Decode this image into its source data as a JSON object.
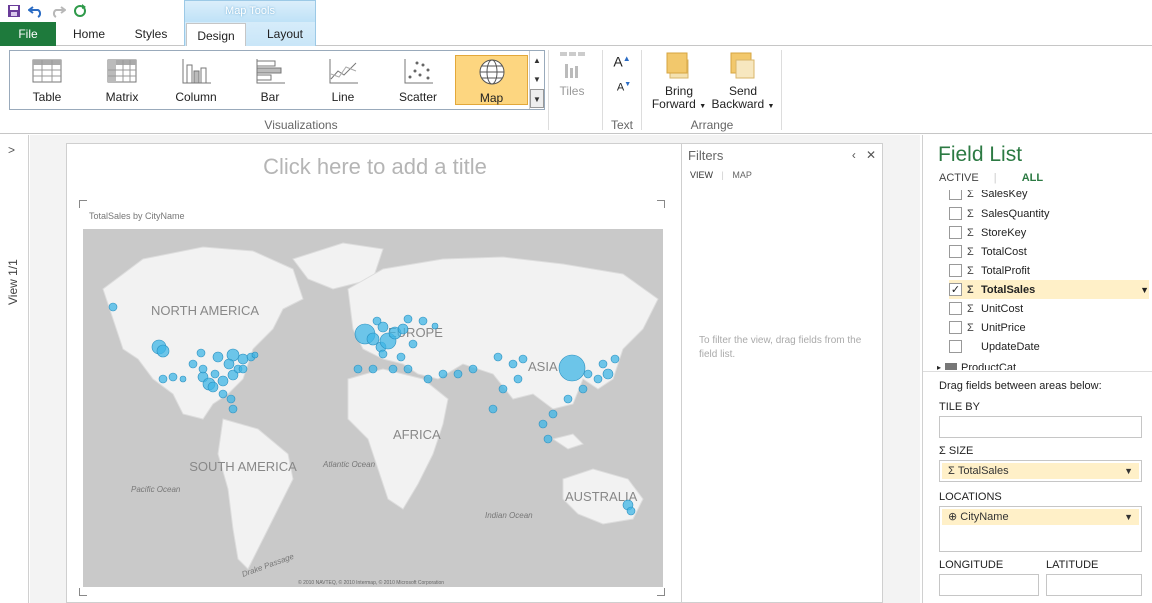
{
  "ribbon_tabs": {
    "file": "File",
    "home": "Home",
    "styles": "Styles",
    "context_group": "Map Tools",
    "design": "Design",
    "layout": "Layout"
  },
  "visualizations": {
    "items": [
      "Table",
      "Matrix",
      "Column",
      "Bar",
      "Line",
      "Scatter",
      "Map"
    ],
    "selected": "Map",
    "group_label": "Visualizations"
  },
  "tiles_label": "Tiles",
  "text_group_label": "Text",
  "arrange": {
    "bring_forward_line1": "Bring",
    "bring_forward_line2": "Forward",
    "send_backward_line1": "Send",
    "send_backward_line2": "Backward",
    "group_label": "Arrange"
  },
  "left_pane": {
    "label": "View  1/1"
  },
  "canvas": {
    "title_placeholder": "Click here to add a title",
    "map_caption": "TotalSales by CityName",
    "map_labels": {
      "north_america": "NORTH AMERICA",
      "europe": "EUROPE",
      "asia": "ASIA",
      "africa": "AFRICA",
      "south_america": "SOUTH AMERICA",
      "australia": "AUSTRALIA",
      "atlantic": "Atlantic Ocean",
      "pacific": "Pacific Ocean",
      "indian": "Indian Ocean",
      "drake": "Drake Passage",
      "copyright": "© 2010 NAVTEQ, © 2010 Intermap, © 2010 Microsoft Corporation"
    }
  },
  "filters": {
    "title": "Filters",
    "tab_view": "VIEW",
    "tab_map": "MAP",
    "hint": "To filter the view, drag fields from the field list."
  },
  "field_list": {
    "title": "Field List",
    "tab_active": "ACTIVE",
    "tab_all": "ALL",
    "fields": [
      {
        "name": "SalesKey",
        "checked": false,
        "sigma": true
      },
      {
        "name": "SalesQuantity",
        "checked": false,
        "sigma": true
      },
      {
        "name": "StoreKey",
        "checked": false,
        "sigma": true
      },
      {
        "name": "TotalCost",
        "checked": false,
        "sigma": true
      },
      {
        "name": "TotalProfit",
        "checked": false,
        "sigma": true
      },
      {
        "name": "TotalSales",
        "checked": true,
        "sigma": true
      },
      {
        "name": "UnitCost",
        "checked": false,
        "sigma": true
      },
      {
        "name": "UnitPrice",
        "checked": false,
        "sigma": true
      },
      {
        "name": "UpdateDate",
        "checked": false,
        "sigma": false
      }
    ],
    "next_table": "ProductCat",
    "drag_hint": "Drag fields between areas below:",
    "tile_by": "TILE BY",
    "size": "SIZE",
    "size_value": "TotalSales",
    "locations": "LOCATIONS",
    "locations_value": "CityName",
    "longitude": "LONGITUDE",
    "latitude": "LATITUDE"
  },
  "colors": {
    "file_tab": "#1e7a3c",
    "field_list_title": "#2c7a43",
    "selected_viz": "#fdd680",
    "bubble": "#3fb6e6"
  }
}
